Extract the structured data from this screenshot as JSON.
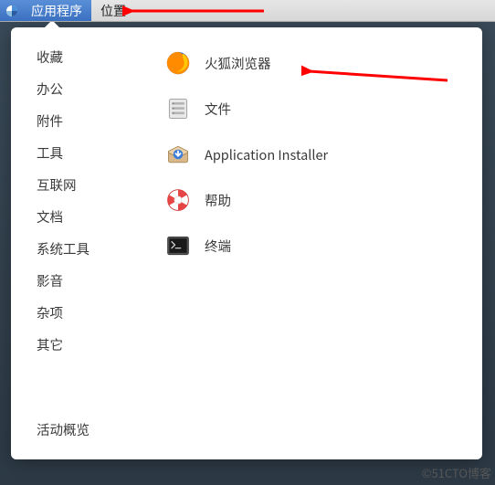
{
  "menubar": {
    "items": [
      {
        "label": "应用程序",
        "active": true
      },
      {
        "label": "位置",
        "active": false
      }
    ]
  },
  "sidebar": {
    "items": [
      {
        "label": "收藏"
      },
      {
        "label": "办公"
      },
      {
        "label": "附件"
      },
      {
        "label": "工具"
      },
      {
        "label": "互联网"
      },
      {
        "label": "文档"
      },
      {
        "label": "系统工具"
      },
      {
        "label": "影音"
      },
      {
        "label": "杂项"
      },
      {
        "label": "其它"
      }
    ]
  },
  "apps": {
    "items": [
      {
        "icon": "firefox-icon",
        "label": "火狐浏览器"
      },
      {
        "icon": "files-icon",
        "label": "文件"
      },
      {
        "icon": "app-installer-icon",
        "label": "Application Installer"
      },
      {
        "icon": "help-icon",
        "label": "帮助"
      },
      {
        "icon": "terminal-icon",
        "label": "终端"
      }
    ]
  },
  "footer": {
    "activities_label": "活动概览"
  },
  "watermark": "©51CTO博客",
  "colors": {
    "menubar_active_start": "#5a8fd8",
    "menubar_active_end": "#3a70c0",
    "popup_bg": "#ffffff",
    "text": "#3a3a3a",
    "arrow": "#ff0000"
  }
}
